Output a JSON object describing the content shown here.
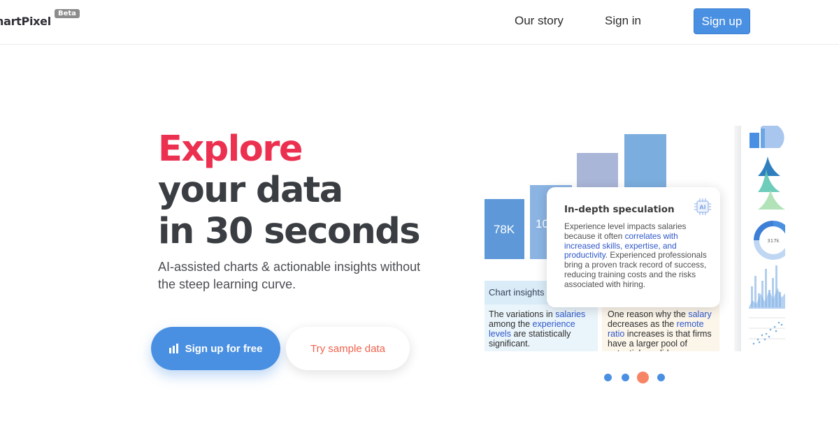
{
  "header": {
    "logo_text": "hartPixel",
    "badge": "Beta",
    "nav": [
      {
        "label": "Our story"
      },
      {
        "label": "Sign in"
      }
    ],
    "signup_label": "Sign up"
  },
  "hero": {
    "headline_accent": "Explore",
    "headline_line2": "your data",
    "headline_line3": "in 30 seconds",
    "subtitle": "AI-assisted charts & actionable insights without the steep learning curve.",
    "cta_primary": "Sign up for free",
    "cta_secondary": "Try sample data"
  },
  "showcase": {
    "bar_label_1": "78K",
    "bar_label_2": "10",
    "card_title": "In-depth speculation",
    "card_icon": "ai-chip-icon",
    "card_body_pre": "Experience level impacts salaries because it often ",
    "card_body_hl1": "correlates with increased skills, expertise, and productivity",
    "card_body_post": ". Experienced professionals bring a proven track record of success, reducing training costs and the risks associated with hiring.",
    "insights_heading": "Chart insights",
    "insight_1": {
      "t1": "The variations in ",
      "h1": "salaries",
      "t2": " among the ",
      "h2": "experience levels",
      "t3": " are statistically significant."
    },
    "insight_2": {
      "t1": "One reason why the ",
      "h1": "salary",
      "t2": " decreases as the ",
      "h2": "remote ratio",
      "t3": " increases is that firms have a larger pool of potential candid"
    },
    "thumb_label": "317k"
  },
  "carousel": {
    "slide_count": 4,
    "active_index": 3
  },
  "colors": {
    "accent_red": "#ec3050",
    "brand_blue": "#4a90e2",
    "cta_orange": "#f0624d",
    "active_dot": "#f88466"
  }
}
